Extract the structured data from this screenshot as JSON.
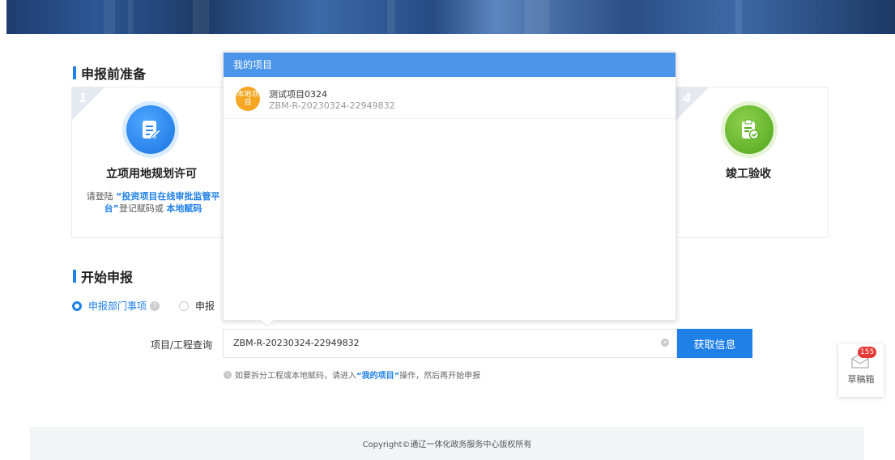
{
  "prep": {
    "title": "申报前准备",
    "step1": {
      "num": "1",
      "title": "立项用地规划许可",
      "desc_prefix": "请登陆 ",
      "desc_link": "“投资项目在线审批监管平台”",
      "desc_mid": "登记赋码或 ",
      "desc_link2": "本地赋码"
    },
    "step4": {
      "num": "4",
      "title": "竣工验收"
    }
  },
  "start": {
    "title": "开始申报",
    "radio1": "申报部门事项",
    "radio2": "申报"
  },
  "query": {
    "label": "项目/工程查询",
    "value": "ZBM-R-20230324-22949832",
    "button": "获取信息",
    "hint_prefix": "如要拆分工程或本地赋码，请进入",
    "hint_link": "“我的项目”",
    "hint_suffix": "操作，然后再开始申报"
  },
  "dropdown": {
    "header": "我的项目",
    "items": [
      {
        "badge": "本地项目",
        "name": "测试项目0324",
        "code": "ZBM-R-20230324-22949832"
      }
    ]
  },
  "draft": {
    "count": "155",
    "label": "草稿箱"
  },
  "footer": {
    "text": "Copyright©通辽一体化政务服务中心版权所有"
  },
  "colors": {
    "accent": "#1f80e8",
    "header_blue": "#4a95ea",
    "badge_orange": "#f5a623",
    "badge_red": "#e53935"
  }
}
